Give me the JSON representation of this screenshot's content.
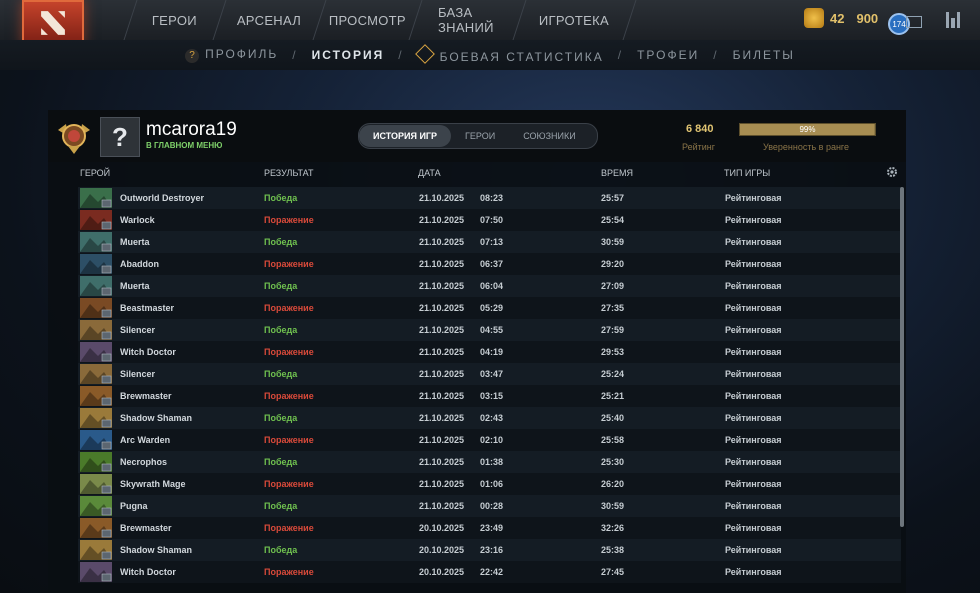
{
  "nav": {
    "items": [
      "ГЕРОИ",
      "АРСЕНАЛ",
      "ПРОСМОТР",
      "БАЗА ЗНАНИЙ",
      "ИГРОТЕКА"
    ]
  },
  "currency": {
    "shards": "42",
    "gold": "900"
  },
  "level_badge": "174",
  "subnav": {
    "items": [
      "ПРОФИЛЬ",
      "ИСТОРИЯ",
      "БОЕВАЯ СТАТИСТИКА",
      "ТРОФЕИ",
      "БИЛЕТЫ"
    ],
    "active": "ИСТОРИЯ"
  },
  "profile": {
    "username": "mcarora19",
    "status": "В ГЛАВНОМ МЕНЮ",
    "avatar_glyph": "?",
    "rating": "6 840",
    "rating_label": "Рейтинг",
    "confidence": 0.99,
    "confidence_text": "99%",
    "confidence_label": "Уверенность в ранге"
  },
  "tabs": [
    "ИСТОРИЯ ИГР",
    "ГЕРОИ",
    "СОЮЗНИКИ"
  ],
  "columns": {
    "hero": "ГЕРОЙ",
    "result": "РЕЗУЛЬТАТ",
    "date": "ДАТА",
    "duration": "ВРЕМЯ",
    "mode": "ТИП ИГРЫ"
  },
  "matches": [
    {
      "hero": "Outworld Destroyer",
      "result": "Победа",
      "win": true,
      "date": "21.10.2025",
      "time": "08:23",
      "duration": "25:57",
      "mode": "Рейтинговая",
      "color": "#3a6f4a"
    },
    {
      "hero": "Warlock",
      "result": "Поражение",
      "win": false,
      "date": "21.10.2025",
      "time": "07:50",
      "duration": "25:54",
      "mode": "Рейтинговая",
      "color": "#7a2b20"
    },
    {
      "hero": "Muerta",
      "result": "Победа",
      "win": true,
      "date": "21.10.2025",
      "time": "07:13",
      "duration": "30:59",
      "mode": "Рейтинговая",
      "color": "#3f6e6a"
    },
    {
      "hero": "Abaddon",
      "result": "Поражение",
      "win": false,
      "date": "21.10.2025",
      "time": "06:37",
      "duration": "29:20",
      "mode": "Рейтинговая",
      "color": "#2d4f66"
    },
    {
      "hero": "Muerta",
      "result": "Победа",
      "win": true,
      "date": "21.10.2025",
      "time": "06:04",
      "duration": "27:09",
      "mode": "Рейтинговая",
      "color": "#3f6e6a"
    },
    {
      "hero": "Beastmaster",
      "result": "Поражение",
      "win": false,
      "date": "21.10.2025",
      "time": "05:29",
      "duration": "27:35",
      "mode": "Рейтинговая",
      "color": "#7a4a24"
    },
    {
      "hero": "Silencer",
      "result": "Победа",
      "win": true,
      "date": "21.10.2025",
      "time": "04:55",
      "duration": "27:59",
      "mode": "Рейтинговая",
      "color": "#8a6a3a"
    },
    {
      "hero": "Witch Doctor",
      "result": "Поражение",
      "win": false,
      "date": "21.10.2025",
      "time": "04:19",
      "duration": "29:53",
      "mode": "Рейтинговая",
      "color": "#5a4a6a"
    },
    {
      "hero": "Silencer",
      "result": "Победа",
      "win": true,
      "date": "21.10.2025",
      "time": "03:47",
      "duration": "25:24",
      "mode": "Рейтинговая",
      "color": "#8a6a3a"
    },
    {
      "hero": "Brewmaster",
      "result": "Поражение",
      "win": false,
      "date": "21.10.2025",
      "time": "03:15",
      "duration": "25:21",
      "mode": "Рейтинговая",
      "color": "#8a5a28"
    },
    {
      "hero": "Shadow Shaman",
      "result": "Победа",
      "win": true,
      "date": "21.10.2025",
      "time": "02:43",
      "duration": "25:40",
      "mode": "Рейтинговая",
      "color": "#9a7a3a"
    },
    {
      "hero": "Arc Warden",
      "result": "Поражение",
      "win": false,
      "date": "21.10.2025",
      "time": "02:10",
      "duration": "25:58",
      "mode": "Рейтинговая",
      "color": "#2a5a8a"
    },
    {
      "hero": "Necrophos",
      "result": "Победа",
      "win": true,
      "date": "21.10.2025",
      "time": "01:38",
      "duration": "25:30",
      "mode": "Рейтинговая",
      "color": "#4a7a2a"
    },
    {
      "hero": "Skywrath Mage",
      "result": "Поражение",
      "win": false,
      "date": "21.10.2025",
      "time": "01:06",
      "duration": "26:20",
      "mode": "Рейтинговая",
      "color": "#7a8a4a"
    },
    {
      "hero": "Pugna",
      "result": "Победа",
      "win": true,
      "date": "21.10.2025",
      "time": "00:28",
      "duration": "30:59",
      "mode": "Рейтинговая",
      "color": "#5a8a3a"
    },
    {
      "hero": "Brewmaster",
      "result": "Поражение",
      "win": false,
      "date": "20.10.2025",
      "time": "23:49",
      "duration": "32:26",
      "mode": "Рейтинговая",
      "color": "#8a5a28"
    },
    {
      "hero": "Shadow Shaman",
      "result": "Победа",
      "win": true,
      "date": "20.10.2025",
      "time": "23:16",
      "duration": "25:38",
      "mode": "Рейтинговая",
      "color": "#9a7a3a"
    },
    {
      "hero": "Witch Doctor",
      "result": "Поражение",
      "win": false,
      "date": "20.10.2025",
      "time": "22:42",
      "duration": "27:45",
      "mode": "Рейтинговая",
      "color": "#5a4a6a"
    }
  ]
}
